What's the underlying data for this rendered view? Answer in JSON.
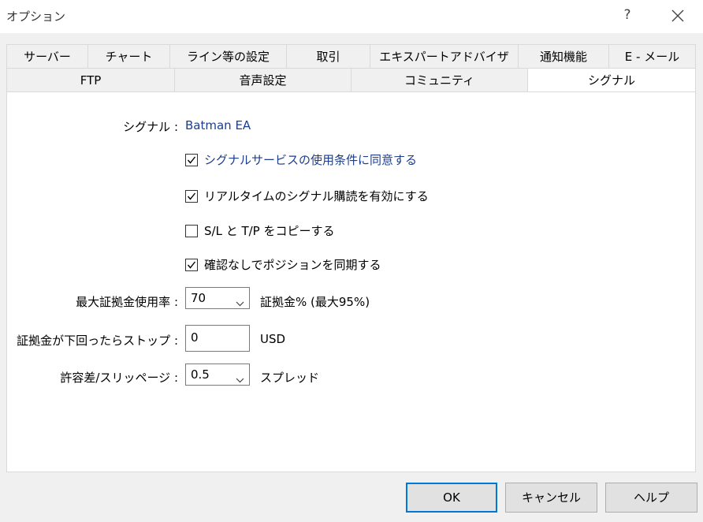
{
  "window": {
    "title": "オプション",
    "help_label": "?"
  },
  "tabs_row1": [
    {
      "label": "サーバー"
    },
    {
      "label": "チャート"
    },
    {
      "label": "ライン等の設定"
    },
    {
      "label": "取引"
    },
    {
      "label": "エキスパートアドバイザ"
    },
    {
      "label": "通知機能"
    },
    {
      "label": "E - メール"
    }
  ],
  "tabs_row2": [
    {
      "label": "FTP"
    },
    {
      "label": "音声設定"
    },
    {
      "label": "コミュニティ"
    },
    {
      "label": "シグナル",
      "active": true
    }
  ],
  "signal": {
    "label": "シグナル :",
    "value": "Batman EA"
  },
  "checkboxes": [
    {
      "label": "シグナルサービスの使用条件に同意する",
      "checked": true
    },
    {
      "label": "リアルタイムのシグナル購読を有効にする",
      "checked": true
    },
    {
      "label": "S/L と T/P をコピーする",
      "checked": false
    },
    {
      "label": "確認なしでポジションを同期する",
      "checked": true
    }
  ],
  "max_margin": {
    "label": "最大証拠金使用率 :",
    "value": "70",
    "unit": "証拠金% (最大95%)"
  },
  "stop_margin": {
    "label": "証拠金が下回ったらストップ :",
    "value": "0",
    "unit": "USD"
  },
  "slippage": {
    "label": "許容差/スリッページ :",
    "value": "0.5",
    "unit": "スプレッド"
  },
  "buttons": {
    "ok": "OK",
    "cancel": "キャンセル",
    "help": "ヘルプ"
  },
  "colors": {
    "link_text": "#1c3d8e",
    "default_button_border": "#0078d7",
    "panel_background": "#ffffff",
    "dialog_background": "#f0f0f0"
  }
}
